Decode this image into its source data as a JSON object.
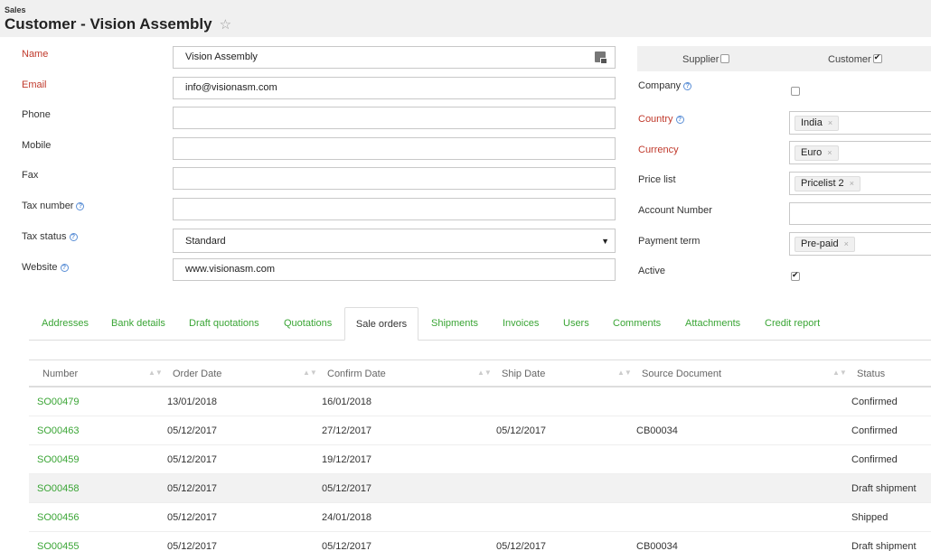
{
  "header": {
    "breadcrumb": "Sales",
    "title": "Customer - Vision Assembly",
    "star": "☆"
  },
  "form": {
    "name_label": "Name",
    "name_value": "Vision Assembly",
    "email_label": "Email",
    "email_value": "info@visionasm.com",
    "phone_label": "Phone",
    "phone_value": "",
    "mobile_label": "Mobile",
    "mobile_value": "",
    "fax_label": "Fax",
    "fax_value": "",
    "tax_number_label": "Tax number",
    "tax_number_value": "",
    "tax_status_label": "Tax status",
    "tax_status_value": "Standard",
    "website_label": "Website",
    "website_value": "www.visionasm.com",
    "supplier_label": "Supplier",
    "supplier_checked": false,
    "customer_label": "Customer",
    "customer_checked": true,
    "company_label": "Company",
    "company_checked": false,
    "country_label": "Country",
    "country_value": "India",
    "currency_label": "Currency",
    "currency_value": "Euro",
    "price_list_label": "Price list",
    "price_list_value": "Pricelist 2",
    "account_number_label": "Account Number",
    "account_number_value": "",
    "payment_term_label": "Payment term",
    "payment_term_value": "Pre-paid",
    "active_label": "Active",
    "active_checked": true,
    "help_glyph": "?",
    "remove_glyph": "×"
  },
  "tabs": [
    "Addresses",
    "Bank details",
    "Draft quotations",
    "Quotations",
    "Sale orders",
    "Shipments",
    "Invoices",
    "Users",
    "Comments",
    "Attachments",
    "Credit report"
  ],
  "active_tab": "Sale orders",
  "grid": {
    "columns": [
      "Number",
      "Order Date",
      "Confirm Date",
      "Ship Date",
      "Source Document",
      "Status"
    ],
    "rows": [
      {
        "number": "SO00479",
        "order_date": "13/01/2018",
        "confirm_date": "16/01/2018",
        "ship_date": "",
        "source": "",
        "status": "Confirmed"
      },
      {
        "number": "SO00463",
        "order_date": "05/12/2017",
        "confirm_date": "27/12/2017",
        "ship_date": "05/12/2017",
        "source": "CB00034",
        "status": "Confirmed"
      },
      {
        "number": "SO00459",
        "order_date": "05/12/2017",
        "confirm_date": "19/12/2017",
        "ship_date": "",
        "source": "",
        "status": "Confirmed"
      },
      {
        "number": "SO00458",
        "order_date": "05/12/2017",
        "confirm_date": "05/12/2017",
        "ship_date": "",
        "source": "",
        "status": "Draft shipment"
      },
      {
        "number": "SO00456",
        "order_date": "05/12/2017",
        "confirm_date": "24/01/2018",
        "ship_date": "",
        "source": "",
        "status": "Shipped"
      },
      {
        "number": "SO00455",
        "order_date": "05/12/2017",
        "confirm_date": "05/12/2017",
        "ship_date": "05/12/2017",
        "source": "CB00034",
        "status": "Draft shipment"
      }
    ]
  },
  "colors": {
    "accent_green": "#3aa535",
    "required_red": "#c0392b",
    "help_blue": "#5b8fd6"
  }
}
